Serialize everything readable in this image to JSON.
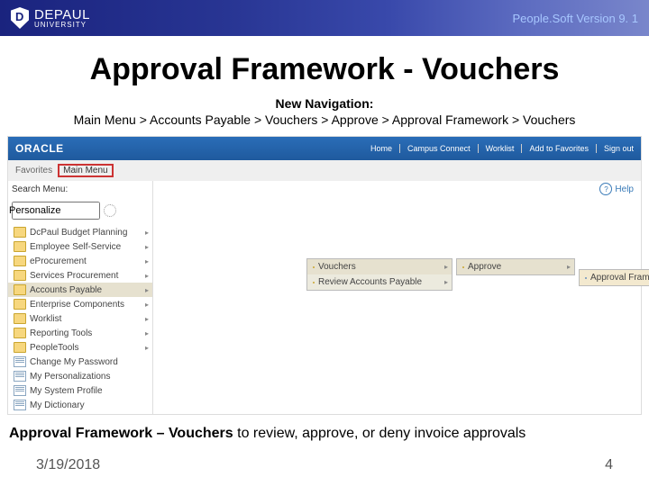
{
  "header": {
    "brand_top": "DEPAUL",
    "brand_bottom": "UNIVERSITY",
    "version": "People.Soft Version 9. 1"
  },
  "slide": {
    "title": "Approval Framework - Vouchers",
    "nav_label": "New Navigation:",
    "nav_path": "Main Menu > Accounts Payable > Vouchers > Approve > Approval Framework > Vouchers",
    "summary_bold": "Approval Framework – Vouchers",
    "summary_rest": " to review, approve, or deny invoice approvals"
  },
  "app": {
    "brand": "ORACLE",
    "links": [
      "Home",
      "Campus Connect",
      "Worklist",
      "Add to Favorites",
      "Sign out"
    ],
    "crumb_favorites": "Favorites",
    "crumb_main": "Main Menu",
    "personalize": "Personalize",
    "search_label": "Search Menu:",
    "help": "Help",
    "menu": [
      "DcPaul Budget Planning",
      "Employee Self-Service",
      "eProcurement",
      "Services Procurement",
      "Accounts Payable",
      "Enterprise Components",
      "Worklist",
      "Reporting Tools",
      "PeopleTools",
      "Change My Password",
      "My Personalizations",
      "My System Profile",
      "My Dictionary"
    ],
    "fly1": [
      "Vouchers",
      "Review Accounts Payable"
    ],
    "fly2": [
      "Approve"
    ],
    "fly3": [
      "Approval Framework - Vouchers"
    ]
  },
  "footer": {
    "date": "3/19/2018",
    "page": "4"
  }
}
